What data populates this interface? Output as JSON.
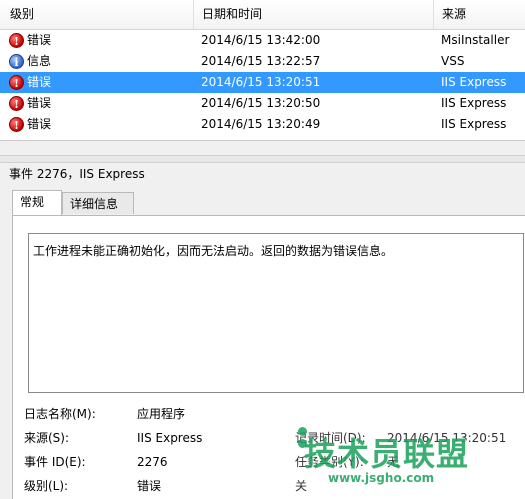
{
  "list": {
    "columns": [
      "级别",
      "日期和时间",
      "来源"
    ],
    "rows": [
      {
        "level": "错误",
        "icon": "error",
        "datetime": "2014/6/15 13:42:00",
        "source": "MsiInstaller",
        "selected": false
      },
      {
        "level": "信息",
        "icon": "info",
        "datetime": "2014/6/15 13:22:57",
        "source": "VSS",
        "selected": false
      },
      {
        "level": "错误",
        "icon": "error",
        "datetime": "2014/6/15 13:20:51",
        "source": "IIS Express",
        "selected": true
      },
      {
        "level": "错误",
        "icon": "error",
        "datetime": "2014/6/15 13:20:50",
        "source": "IIS Express",
        "selected": false
      },
      {
        "level": "错误",
        "icon": "error",
        "datetime": "2014/6/15 13:20:49",
        "source": "IIS Express",
        "selected": false
      }
    ]
  },
  "details": {
    "title": "事件 2276，IIS Express",
    "tabs": [
      "常规",
      "详细信息"
    ],
    "active_tab": "常规",
    "message": "工作进程未能正确初始化，因而无法启动。返回的数据为错误信息。",
    "properties": {
      "log_name_label": "日志名称(M):",
      "log_name_value": "应用程序",
      "source_label": "来源(S):",
      "source_value": "IIS Express",
      "event_id_label": "事件 ID(E):",
      "event_id_value": "2276",
      "level_label": "级别(L):",
      "level_value": "错误",
      "logged_label": "记录时间(D):",
      "logged_value": "2014/6/15 13:20:51",
      "task_label": "任务类别(Y):",
      "task_value": "无",
      "keywords_label": "关"
    }
  },
  "watermark": {
    "text": "技术员联盟",
    "url": "www.jsgho.com"
  },
  "colors": {
    "selection": "#3399ff",
    "error_icon": "#c00000",
    "info_icon": "#2e64c9",
    "watermark": "#1aa05a"
  }
}
